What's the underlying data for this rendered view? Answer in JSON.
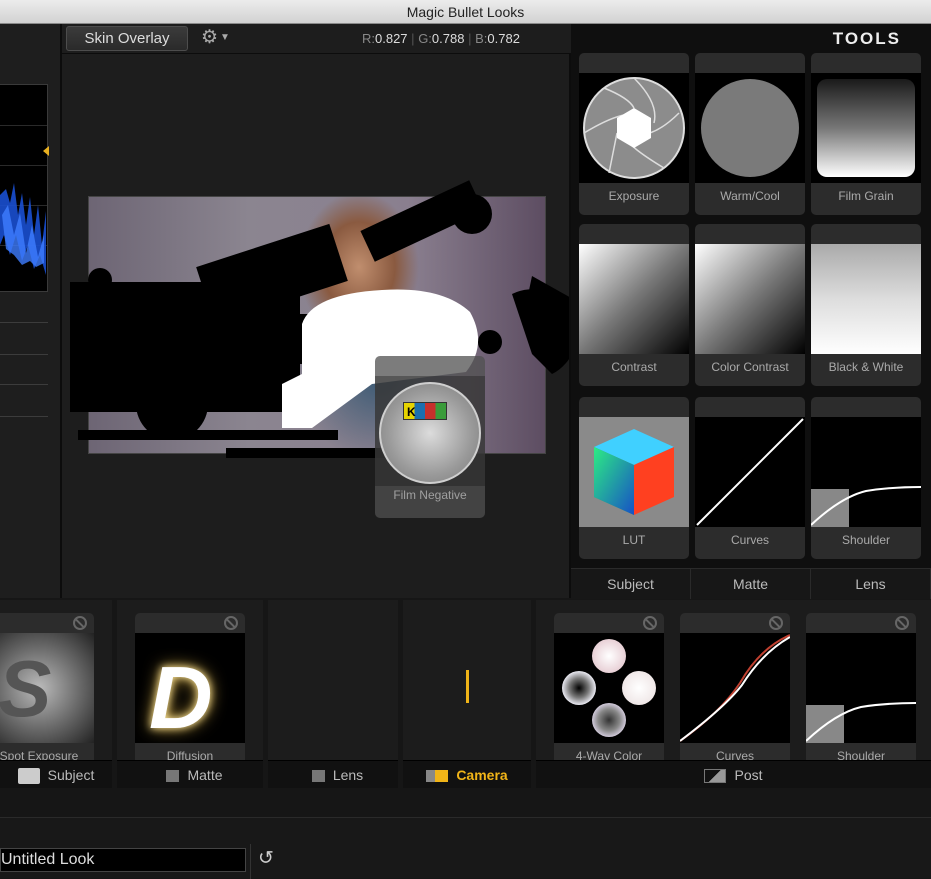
{
  "window": {
    "title": "Magic Bullet Looks"
  },
  "toolbar": {
    "preset_button": "Skin Overlay",
    "gear_icon": "gear-icon",
    "rgb": {
      "r_label": "R:",
      "r": "0.827",
      "g_label": "G:",
      "g": "0.788",
      "b_label": "B:",
      "b": "0.782"
    }
  },
  "viewer": {
    "dragging_tool_label": "Film Negative",
    "dragging_tool_letter": "K"
  },
  "tools": {
    "title": "TOOLS",
    "items": [
      {
        "label": "Exposure"
      },
      {
        "label": "Warm/Cool"
      },
      {
        "label": "Film Grain"
      },
      {
        "label": "Contrast"
      },
      {
        "label": "Color Contrast"
      },
      {
        "label": "Black & White"
      },
      {
        "label": "LUT"
      },
      {
        "label": "Curves"
      },
      {
        "label": "Shoulder"
      }
    ],
    "tabs": [
      {
        "label": "Subject"
      },
      {
        "label": "Matte"
      },
      {
        "label": "Lens"
      }
    ]
  },
  "pipeline": {
    "stages": [
      {
        "label": "Subject",
        "tools": [
          {
            "label": "Spot Exposure",
            "letter": "S"
          }
        ]
      },
      {
        "label": "Matte",
        "tools": [
          {
            "label": "Diffusion",
            "letter": "D"
          }
        ]
      },
      {
        "label": "Lens",
        "tools": []
      },
      {
        "label": "Camera",
        "tools": [],
        "active": true
      },
      {
        "label": "Post",
        "tools": [
          {
            "label": "4-Way Color"
          },
          {
            "label": "Curves"
          },
          {
            "label": "Shoulder"
          }
        ]
      }
    ],
    "accent_color": "#f0b418"
  },
  "bottombar": {
    "look_name": "Untitled Look",
    "reset_icon": "reset-icon"
  }
}
